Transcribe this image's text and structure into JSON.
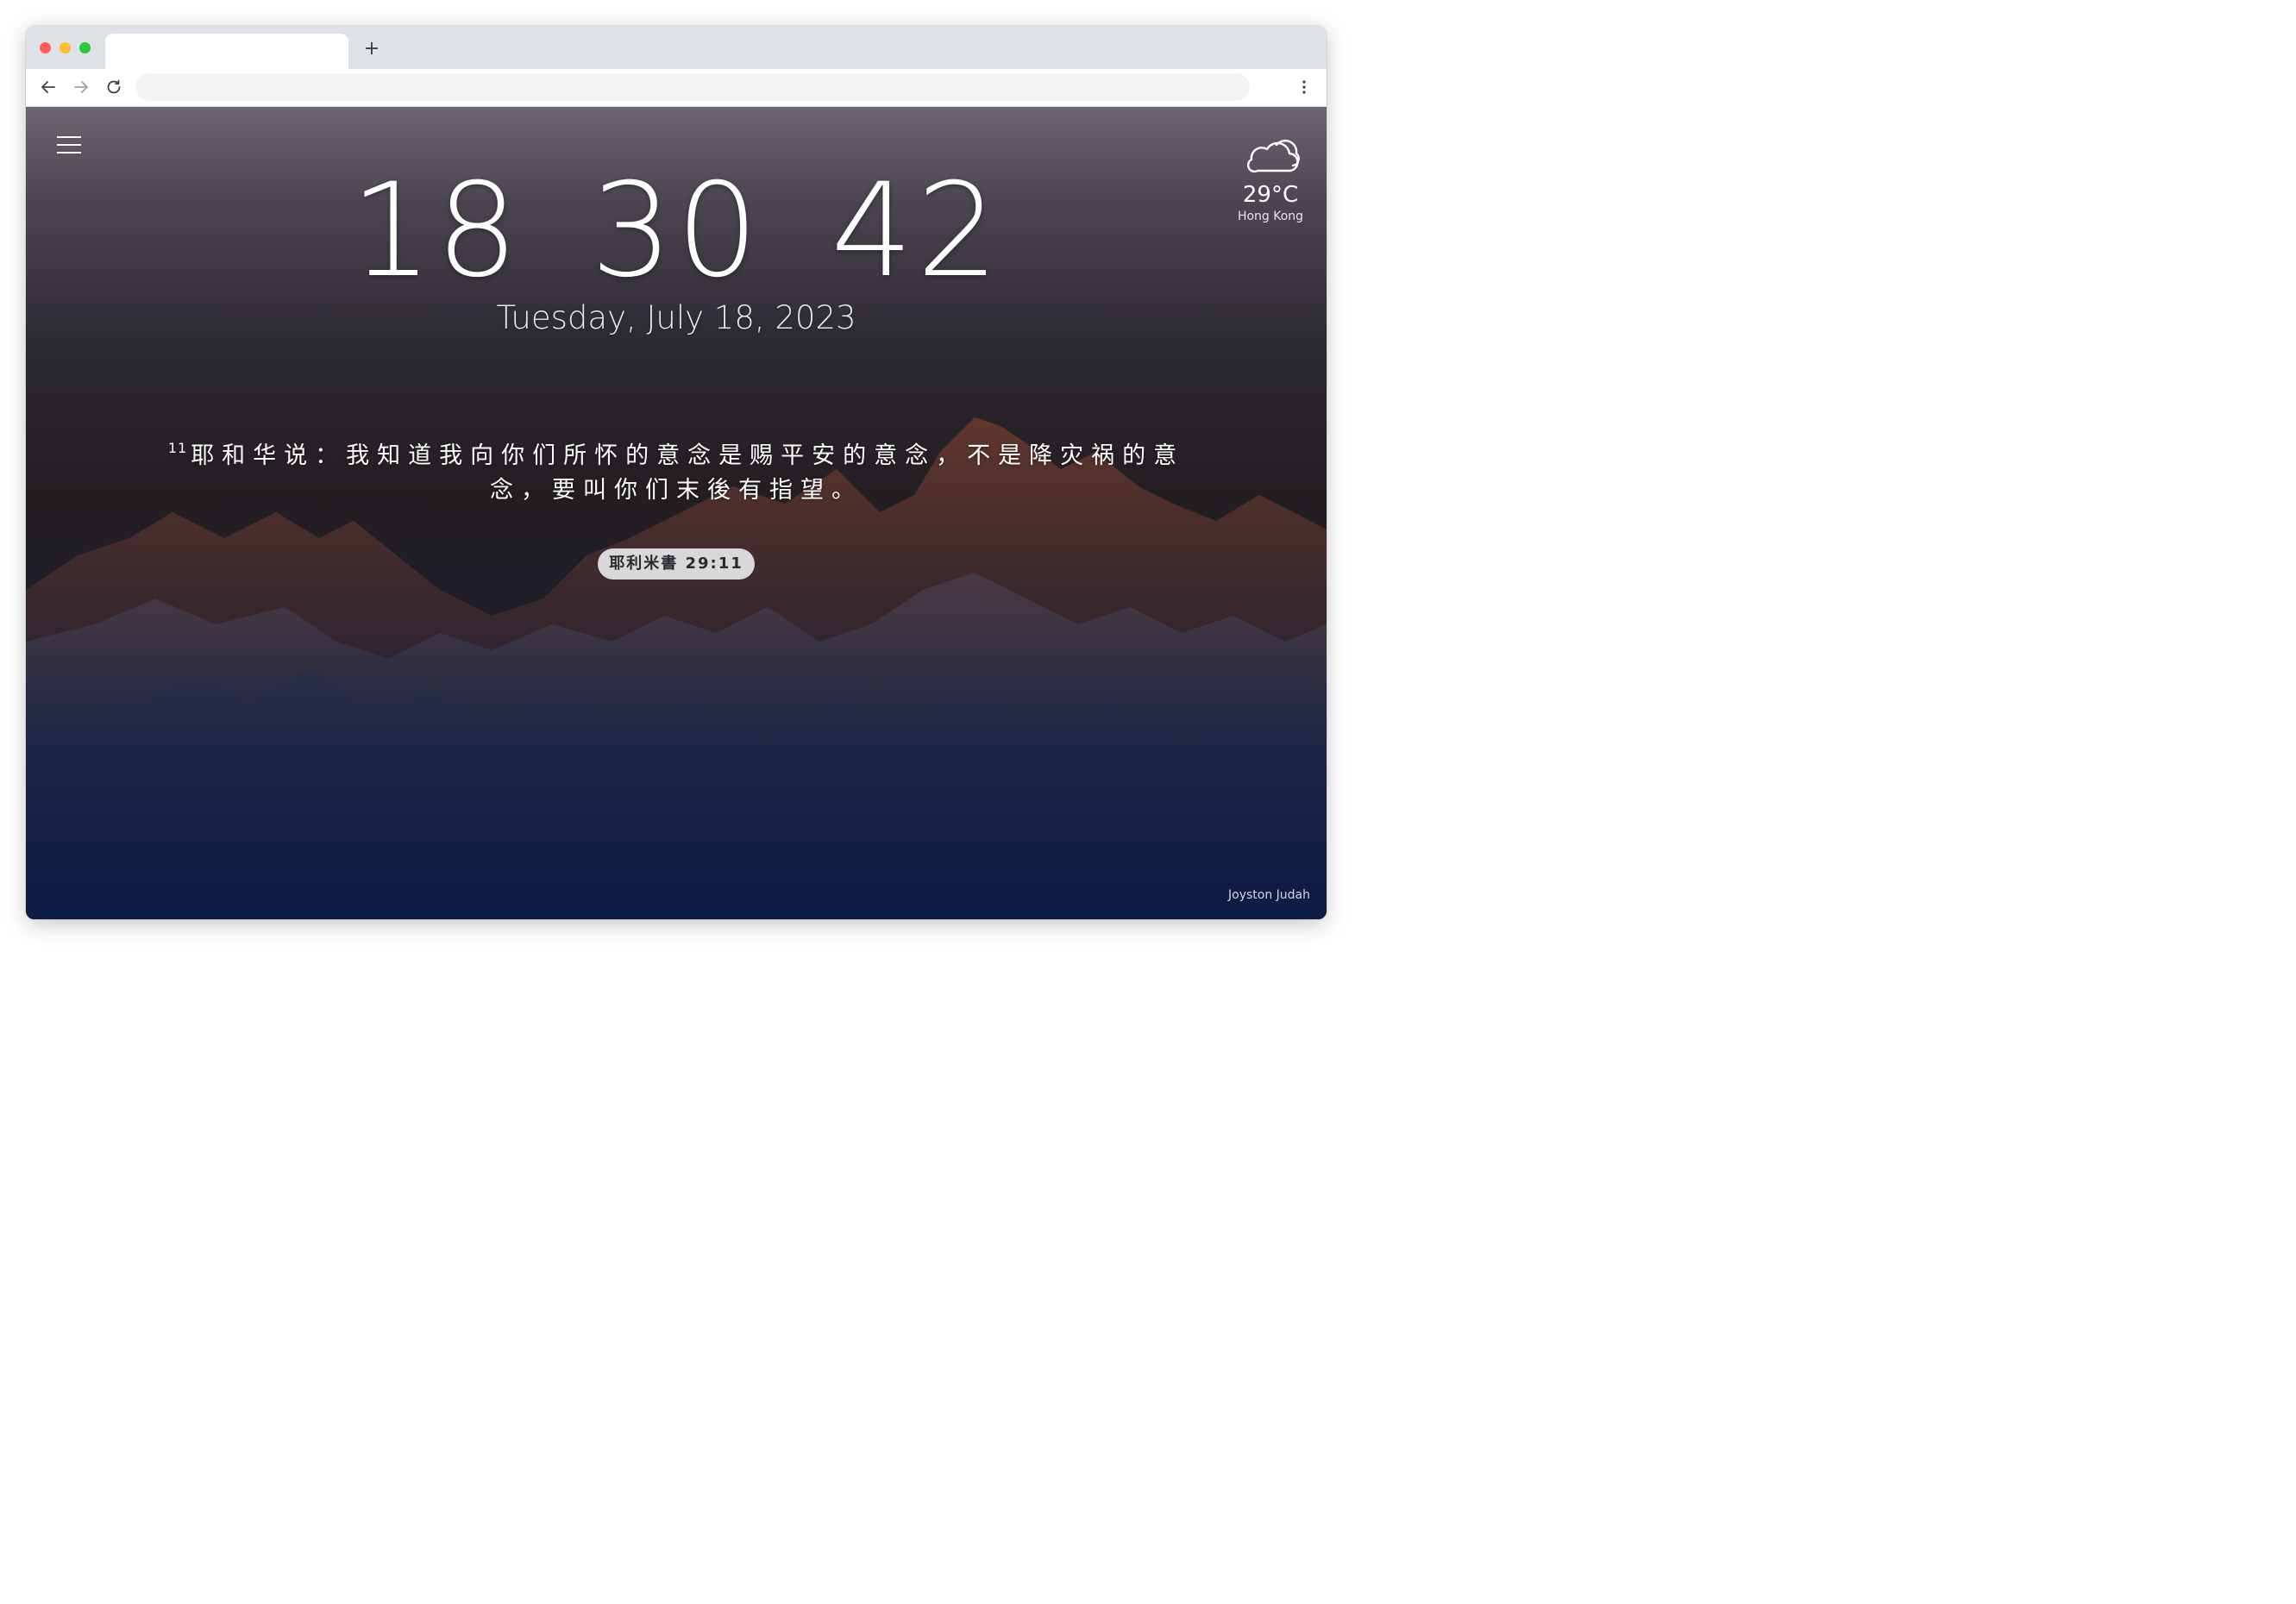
{
  "browser": {
    "tab_title": "",
    "new_tab_label": "+",
    "address": ""
  },
  "clock": {
    "hours": "18",
    "minutes": "30",
    "seconds": "42"
  },
  "date": "Tuesday, July 18, 2023",
  "weather": {
    "icon": "cloud-icon",
    "temperature": "29°C",
    "city": "Hong Kong"
  },
  "verse": {
    "number": "11",
    "text": "耶和华说：我知道我向你们所怀的意念是赐平安的意念，不是降灾祸的意念，要叫你们末後有指望。",
    "reference": "耶利米書 29:11"
  },
  "photo_credit": "Joyston Judah",
  "colors": {
    "traffic_red": "#ff5f57",
    "traffic_yellow": "#febc2e",
    "traffic_green": "#28c840",
    "pill_bg": "#d9d7d9"
  }
}
